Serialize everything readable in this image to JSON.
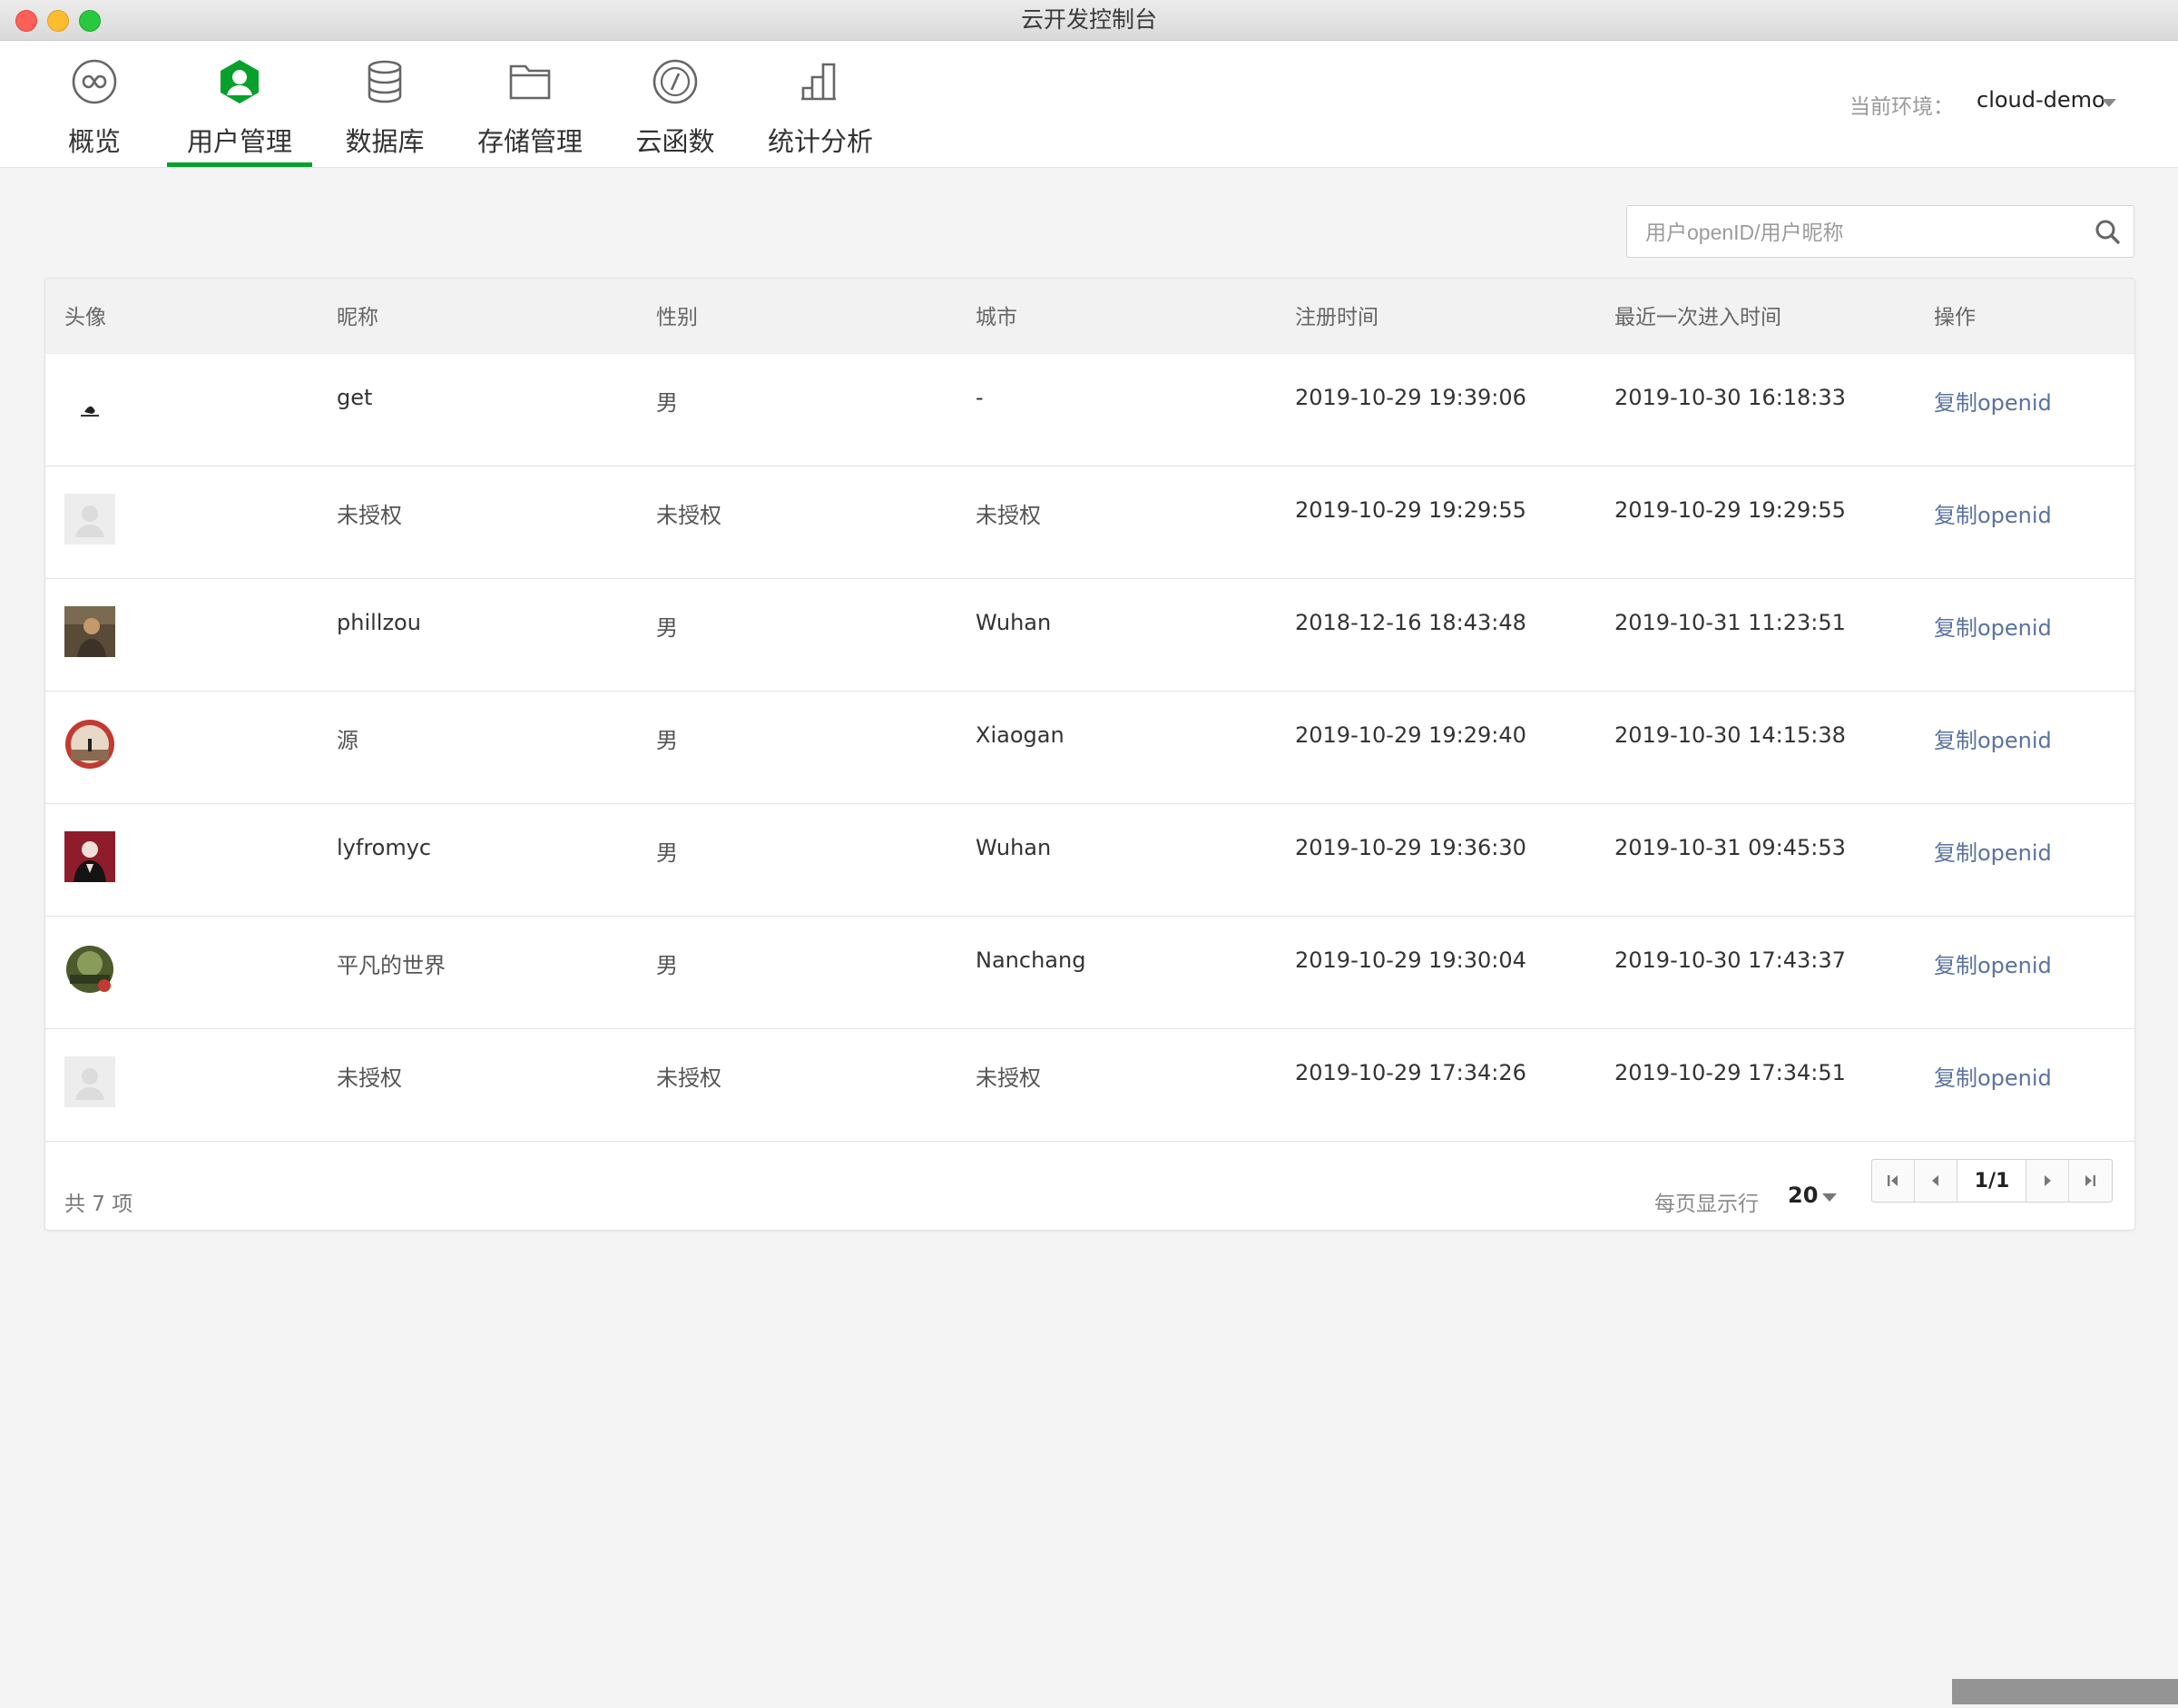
{
  "window": {
    "title": "云开发控制台"
  },
  "nav": {
    "items": [
      {
        "label": "概览",
        "icon": "infinity-icon"
      },
      {
        "label": "用户管理",
        "icon": "user-icon",
        "active": true
      },
      {
        "label": "数据库",
        "icon": "database-icon"
      },
      {
        "label": "存储管理",
        "icon": "folder-icon"
      },
      {
        "label": "云函数",
        "icon": "code-icon"
      },
      {
        "label": "统计分析",
        "icon": "bar-chart-icon"
      }
    ],
    "active_color": "#07a02a"
  },
  "env": {
    "label": "当前环境：",
    "value": "cloud-demo"
  },
  "search": {
    "placeholder": "用户openID/用户昵称"
  },
  "table": {
    "columns": [
      "头像",
      "昵称",
      "性别",
      "城市",
      "注册时间",
      "最近一次进入时间",
      "操作"
    ],
    "rows": [
      {
        "avatar": "avatar-ink-drawing",
        "nickname": "get",
        "gender": "男",
        "city": "-",
        "registered": "2019-10-29 19:39:06",
        "last_visit": "2019-10-30 16:18:33",
        "action": "复制openid"
      },
      {
        "avatar": "avatar-default",
        "nickname": "未授权",
        "gender": "未授权",
        "city": "未授权",
        "registered": "2019-10-29 19:29:55",
        "last_visit": "2019-10-29 19:29:55",
        "action": "复制openid"
      },
      {
        "avatar": "avatar-photo-portrait",
        "nickname": "phillzou",
        "gender": "男",
        "city": "Wuhan",
        "registered": "2018-12-16 18:43:48",
        "last_visit": "2019-10-31 11:23:51",
        "action": "复制openid"
      },
      {
        "avatar": "avatar-red-circle",
        "nickname": "源",
        "gender": "男",
        "city": "Xiaogan",
        "registered": "2019-10-29 19:29:40",
        "last_visit": "2019-10-30 14:15:38",
        "action": "复制openid"
      },
      {
        "avatar": "avatar-red-figure",
        "nickname": "lyfromyc",
        "gender": "男",
        "city": "Wuhan",
        "registered": "2019-10-29 19:36:30",
        "last_visit": "2019-10-31 09:45:53",
        "action": "复制openid"
      },
      {
        "avatar": "avatar-green-circle",
        "nickname": "平凡的世界",
        "gender": "男",
        "city": "Nanchang",
        "registered": "2019-10-29 19:30:04",
        "last_visit": "2019-10-30 17:43:37",
        "action": "复制openid"
      },
      {
        "avatar": "avatar-default",
        "nickname": "未授权",
        "gender": "未授权",
        "city": "未授权",
        "registered": "2019-10-29 17:34:26",
        "last_visit": "2019-10-29 17:34:51",
        "action": "复制openid"
      }
    ]
  },
  "footer": {
    "total": "共 7 项",
    "per_page_label": "每页显示行",
    "per_page_value": "20",
    "page_indicator": "1/1"
  },
  "colors": {
    "link": "#5a72a0",
    "header_bg": "#f2f2f2",
    "page_bg": "#f4f4f4"
  }
}
